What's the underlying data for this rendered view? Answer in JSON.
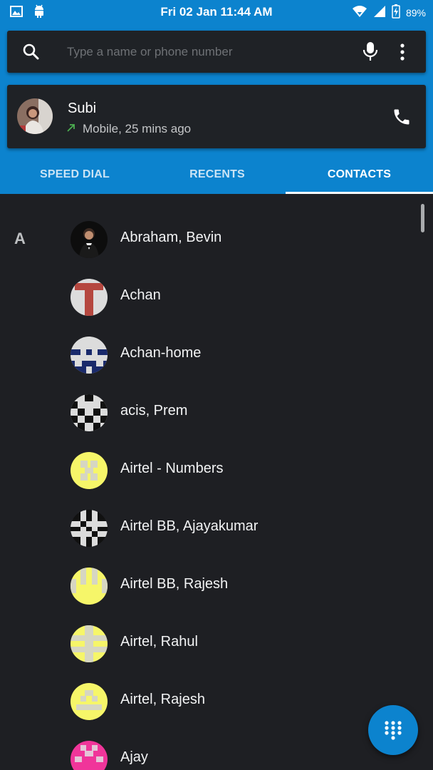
{
  "status_bar": {
    "time": "Fri 02 Jan 11:44 AM",
    "battery": "89%",
    "icons": [
      "image-icon",
      "android-icon",
      "wifi-icon",
      "signal-icon",
      "battery-charging-icon"
    ]
  },
  "search": {
    "placeholder": "Type a name or phone number"
  },
  "recent_call": {
    "name": "Subi",
    "detail": "Mobile, 25 mins ago"
  },
  "tabs": [
    {
      "label": "SPEED DIAL"
    },
    {
      "label": "RECENTS"
    },
    {
      "label": "CONTACTS"
    }
  ],
  "active_tab": "CONTACTS",
  "contacts": {
    "section": "A",
    "items": [
      {
        "name": "Abraham, Bevin"
      },
      {
        "name": "Achan"
      },
      {
        "name": "Achan-home"
      },
      {
        "name": "acis, Prem"
      },
      {
        "name": "Airtel - Numbers"
      },
      {
        "name": "Airtel BB, Ajayakumar"
      },
      {
        "name": "Airtel BB, Rajesh"
      },
      {
        "name": "Airtel, Rahul"
      },
      {
        "name": "Airtel, Rajesh"
      },
      {
        "name": "Ajay"
      }
    ]
  },
  "colors": {
    "accent": "#0c83ce",
    "background": "#1e1f23",
    "card": "#1f2226"
  }
}
